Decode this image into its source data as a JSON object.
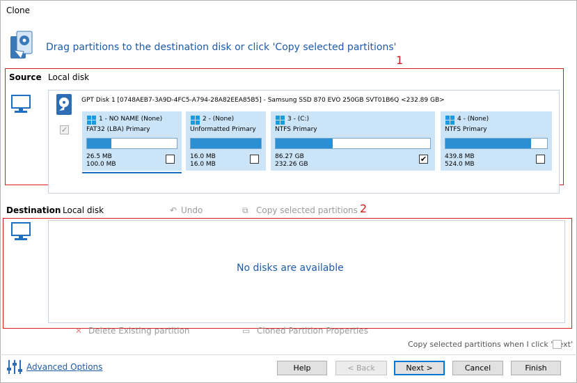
{
  "window": {
    "title": "Clone"
  },
  "header": {
    "instruction": "Drag partitions to the destination disk or click 'Copy selected partitions'"
  },
  "source": {
    "label": "Source",
    "disk_type": "Local disk",
    "marker": "1",
    "disk_title": "GPT Disk 1 [0748AEB7-3A9D-4FC5-A794-28A82EEA85B5] - Samsung SSD 870 EVO 250GB SVT01B6Q  <232.89 GB>",
    "disk_checked": true,
    "partitions": [
      {
        "title": "1 - NO NAME (None)",
        "fs": "FAT32 (LBA) Primary",
        "used": "26.5 MB",
        "total": "100.0 MB",
        "fill": 0.27,
        "checked": false
      },
      {
        "title": "2 -  (None)",
        "fs": "Unformatted Primary",
        "used": "16.0 MB",
        "total": "16.0 MB",
        "fill": 1.0,
        "checked": false
      },
      {
        "title": "3 -  (C:)",
        "fs": "NTFS Primary",
        "used": "86.27 GB",
        "total": "232.26 GB",
        "fill": 0.37,
        "checked": true
      },
      {
        "title": "4 -  (None)",
        "fs": "NTFS Primary",
        "used": "439.8 MB",
        "total": "524.0 MB",
        "fill": 0.84,
        "checked": false
      }
    ]
  },
  "destination": {
    "label": "Destination",
    "disk_type": "Local disk",
    "undo": "Undo",
    "copy_selected": "Copy selected partitions",
    "marker": "2",
    "empty_message": "No disks are available"
  },
  "actions": {
    "delete_existing": "Delete Existing partition",
    "cloned_props": "Cloned Partition Properties",
    "copy_on_next": "Copy selected partitions when I click 'Next'"
  },
  "footer": {
    "advanced_options": "Advanced Options",
    "help": "Help",
    "back": "< Back",
    "next": "Next >",
    "cancel": "Cancel",
    "finish": "Finish"
  },
  "colors": {
    "accent": "#1e5aa8",
    "partition_bg": "#cce4f7",
    "bar_fill": "#2b8fd3",
    "annotation_red": "#d21e1e"
  }
}
